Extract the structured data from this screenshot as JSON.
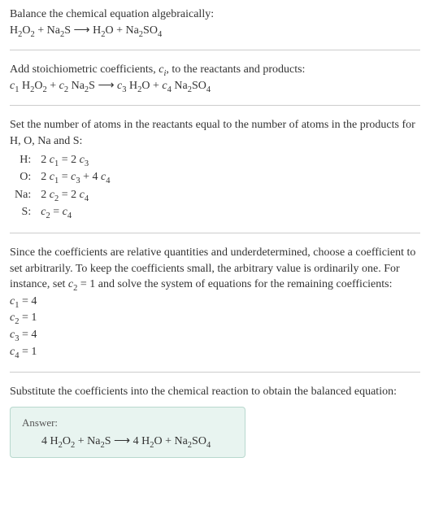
{
  "section1": {
    "title": "Balance the chemical equation algebraically:",
    "equation_html": "H<span class='sub'>2</span>O<span class='sub'>2</span> + Na<span class='sub'>2</span>S ⟶ H<span class='sub'>2</span>O + Na<span class='sub'>2</span>SO<span class='sub'>4</span>"
  },
  "section2": {
    "title_html": "Add stoichiometric coefficients, <span class='italic'>c<span class='sub'>i</span></span>, to the reactants and products:",
    "equation_html": "<span class='italic'>c</span><span class='sub'>1</span> H<span class='sub'>2</span>O<span class='sub'>2</span> + <span class='italic'>c</span><span class='sub'>2</span> Na<span class='sub'>2</span>S ⟶ <span class='italic'>c</span><span class='sub'>3</span> H<span class='sub'>2</span>O + <span class='italic'>c</span><span class='sub'>4</span> Na<span class='sub'>2</span>SO<span class='sub'>4</span>"
  },
  "section3": {
    "title": "Set the number of atoms in the reactants equal to the number of atoms in the products for H, O, Na and S:",
    "rows": [
      {
        "element": "H:",
        "eq_html": "2 <span class='italic'>c</span><span class='sub'>1</span> = 2 <span class='italic'>c</span><span class='sub'>3</span>"
      },
      {
        "element": "O:",
        "eq_html": "2 <span class='italic'>c</span><span class='sub'>1</span> = <span class='italic'>c</span><span class='sub'>3</span> + 4 <span class='italic'>c</span><span class='sub'>4</span>"
      },
      {
        "element": "Na:",
        "eq_html": "2 <span class='italic'>c</span><span class='sub'>2</span> = 2 <span class='italic'>c</span><span class='sub'>4</span>"
      },
      {
        "element": "S:",
        "eq_html": "<span class='italic'>c</span><span class='sub'>2</span> = <span class='italic'>c</span><span class='sub'>4</span>"
      }
    ]
  },
  "section4": {
    "title_html": "Since the coefficients are relative quantities and underdetermined, choose a coefficient to set arbitrarily. To keep the coefficients small, the arbitrary value is ordinarily one. For instance, set <span class='italic'>c</span><span class='sub'>2</span> = 1 and solve the system of equations for the remaining coefficients:",
    "coeffs": [
      {
        "html": "<span class='italic'>c</span><span class='sub'>1</span> = 4"
      },
      {
        "html": "<span class='italic'>c</span><span class='sub'>2</span> = 1"
      },
      {
        "html": "<span class='italic'>c</span><span class='sub'>3</span> = 4"
      },
      {
        "html": "<span class='italic'>c</span><span class='sub'>4</span> = 1"
      }
    ]
  },
  "section5": {
    "title": "Substitute the coefficients into the chemical reaction to obtain the balanced equation:",
    "answer_label": "Answer:",
    "answer_html": "4 H<span class='sub'>2</span>O<span class='sub'>2</span> + Na<span class='sub'>2</span>S ⟶ 4 H<span class='sub'>2</span>O + Na<span class='sub'>2</span>SO<span class='sub'>4</span>"
  }
}
